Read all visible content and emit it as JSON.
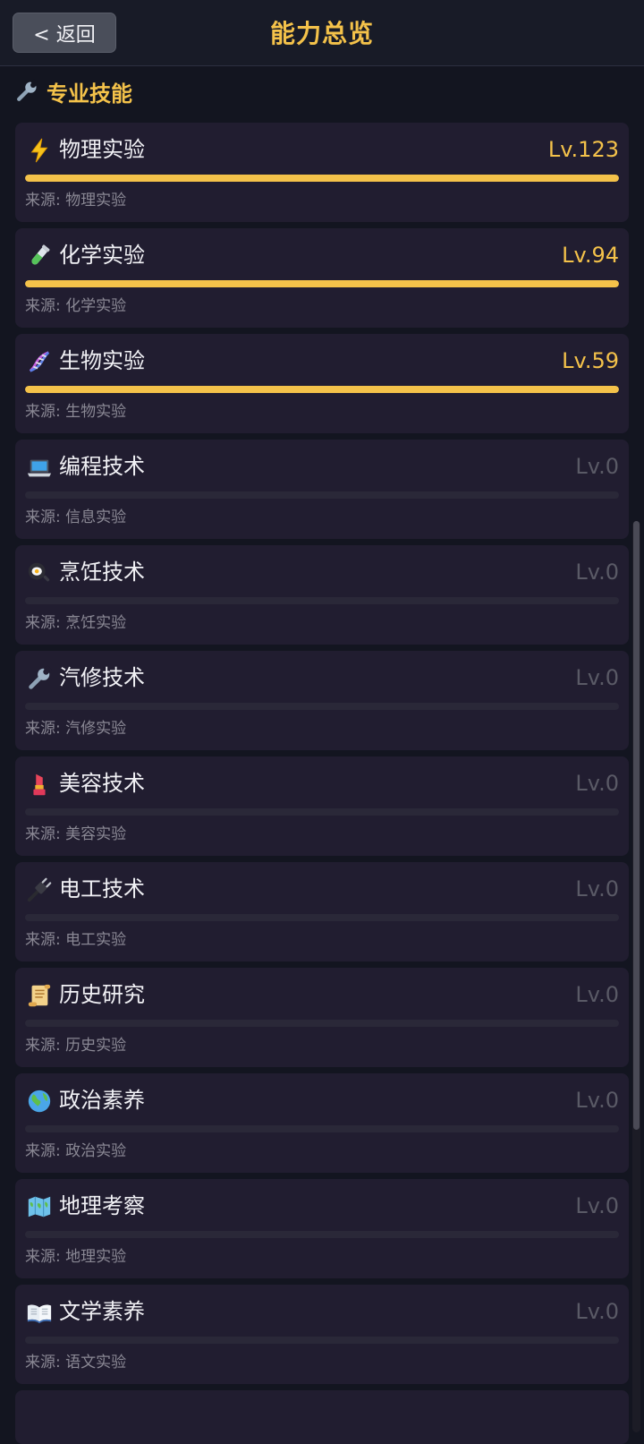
{
  "header": {
    "back_label": "< 返回",
    "title": "能力总览"
  },
  "section": {
    "title": "专业技能",
    "icon": "wrench-icon"
  },
  "colors": {
    "accent": "#f4c24a",
    "card_bg": "#211d30",
    "page_bg": "#131520"
  },
  "skills": [
    {
      "icon": "lightning-icon",
      "name": "物理实验",
      "level": "Lv.123",
      "progress": 1.0,
      "source": "来源: 物理实验"
    },
    {
      "icon": "test-tube-icon",
      "name": "化学实验",
      "level": "Lv.94",
      "progress": 1.0,
      "source": "来源: 化学实验"
    },
    {
      "icon": "dna-icon",
      "name": "生物实验",
      "level": "Lv.59",
      "progress": 1.0,
      "source": "来源: 生物实验"
    },
    {
      "icon": "laptop-icon",
      "name": "编程技术",
      "level": "Lv.0",
      "progress": 0,
      "source": "来源: 信息实验"
    },
    {
      "icon": "frying-pan-icon",
      "name": "烹饪技术",
      "level": "Lv.0",
      "progress": 0,
      "source": "来源: 烹饪实验"
    },
    {
      "icon": "wrench-icon",
      "name": "汽修技术",
      "level": "Lv.0",
      "progress": 0,
      "source": "来源: 汽修实验"
    },
    {
      "icon": "lipstick-icon",
      "name": "美容技术",
      "level": "Lv.0",
      "progress": 0,
      "source": "来源: 美容实验"
    },
    {
      "icon": "electric-plug-icon",
      "name": "电工技术",
      "level": "Lv.0",
      "progress": 0,
      "source": "来源: 电工实验"
    },
    {
      "icon": "scroll-icon",
      "name": "历史研究",
      "level": "Lv.0",
      "progress": 0,
      "source": "来源: 历史实验"
    },
    {
      "icon": "globe-icon",
      "name": "政治素养",
      "level": "Lv.0",
      "progress": 0,
      "source": "来源: 政治实验"
    },
    {
      "icon": "world-map-icon",
      "name": "地理考察",
      "level": "Lv.0",
      "progress": 0,
      "source": "来源: 地理实验"
    },
    {
      "icon": "open-book-icon",
      "name": "文学素养",
      "level": "Lv.0",
      "progress": 0,
      "source": "来源: 语文实验"
    }
  ]
}
